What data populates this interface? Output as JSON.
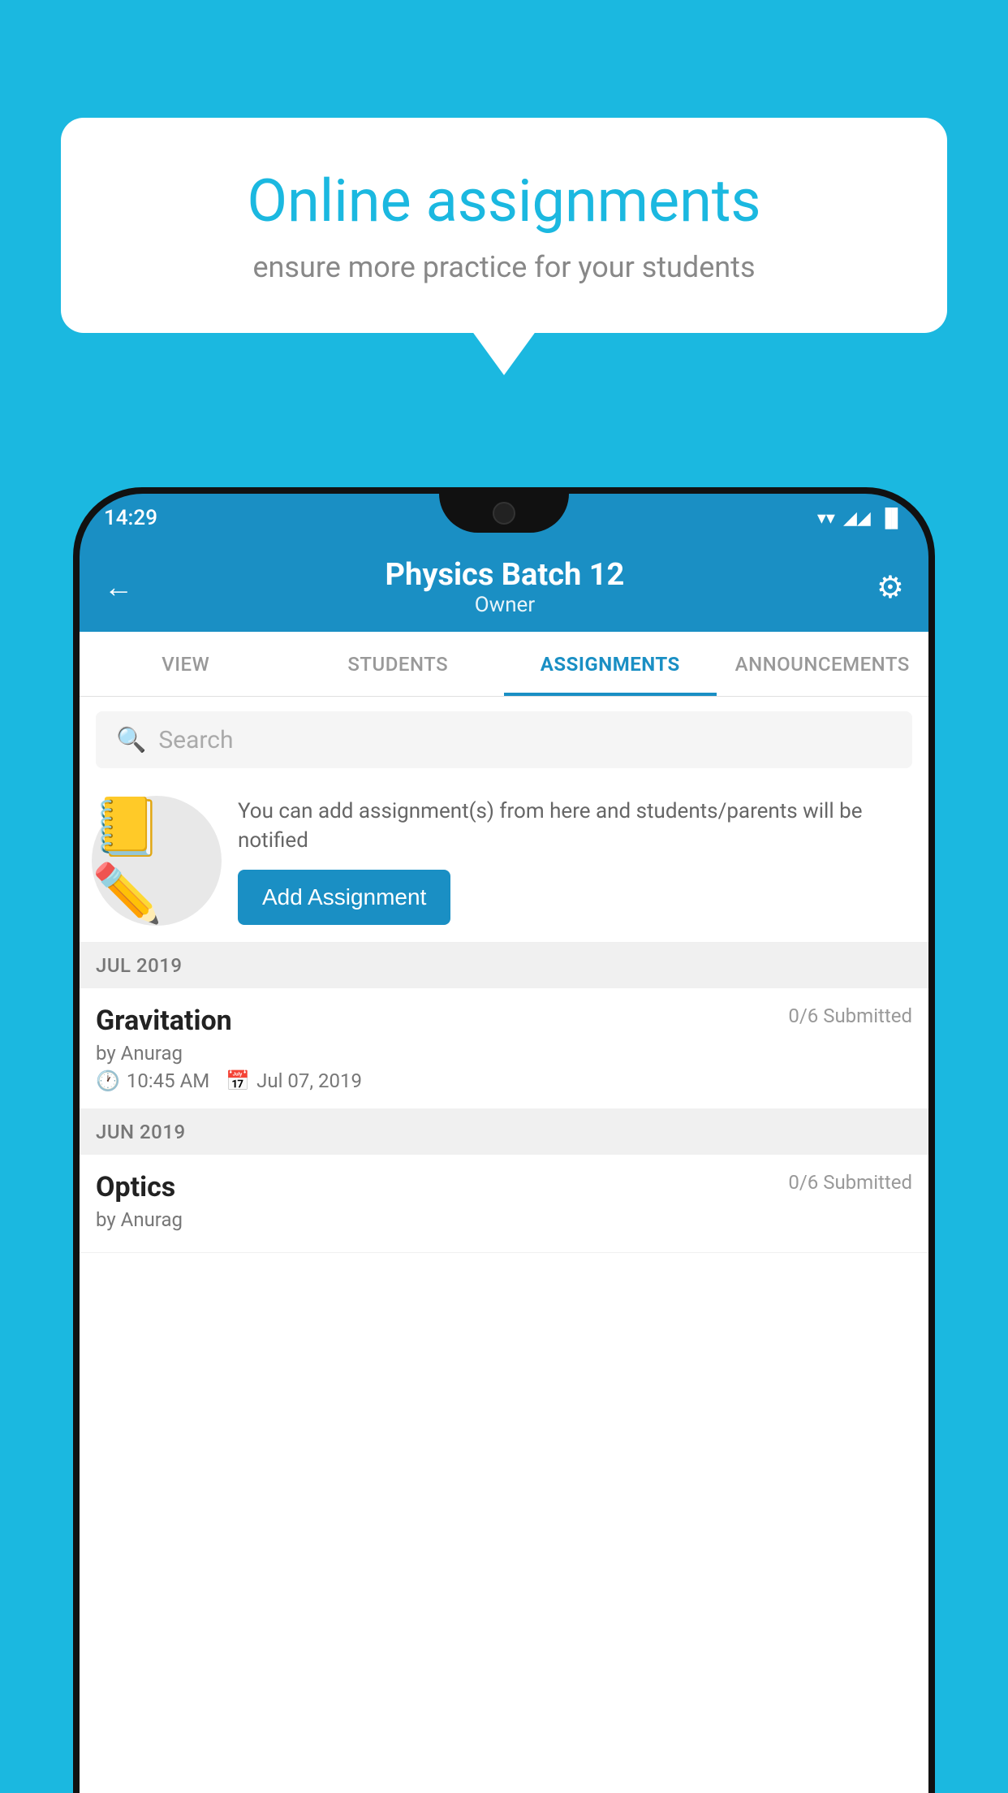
{
  "background_color": "#1BB8E0",
  "speech_bubble": {
    "title": "Online assignments",
    "subtitle": "ensure more practice for your students"
  },
  "status_bar": {
    "time": "14:29",
    "wifi": "▼",
    "signal": "▲",
    "battery": "▐"
  },
  "header": {
    "title": "Physics Batch 12",
    "subtitle": "Owner",
    "back_label": "←",
    "gear_label": "⚙"
  },
  "tabs": [
    {
      "id": "view",
      "label": "VIEW",
      "active": false
    },
    {
      "id": "students",
      "label": "STUDENTS",
      "active": false
    },
    {
      "id": "assignments",
      "label": "ASSIGNMENTS",
      "active": true
    },
    {
      "id": "announcements",
      "label": "ANNOUNCEMENTS",
      "active": false
    }
  ],
  "search": {
    "placeholder": "Search"
  },
  "promo": {
    "description": "You can add assignment(s) from here and students/parents will be notified",
    "button_label": "Add Assignment"
  },
  "sections": [
    {
      "month": "JUL 2019",
      "assignments": [
        {
          "name": "Gravitation",
          "submitted": "0/6 Submitted",
          "by": "by Anurag",
          "time": "10:45 AM",
          "date": "Jul 07, 2019"
        }
      ]
    },
    {
      "month": "JUN 2019",
      "assignments": [
        {
          "name": "Optics",
          "submitted": "0/6 Submitted",
          "by": "by Anurag",
          "time": "",
          "date": ""
        }
      ]
    }
  ],
  "icons": {
    "notebook": "📓",
    "search": "🔍",
    "clock": "🕐",
    "calendar": "📅"
  }
}
